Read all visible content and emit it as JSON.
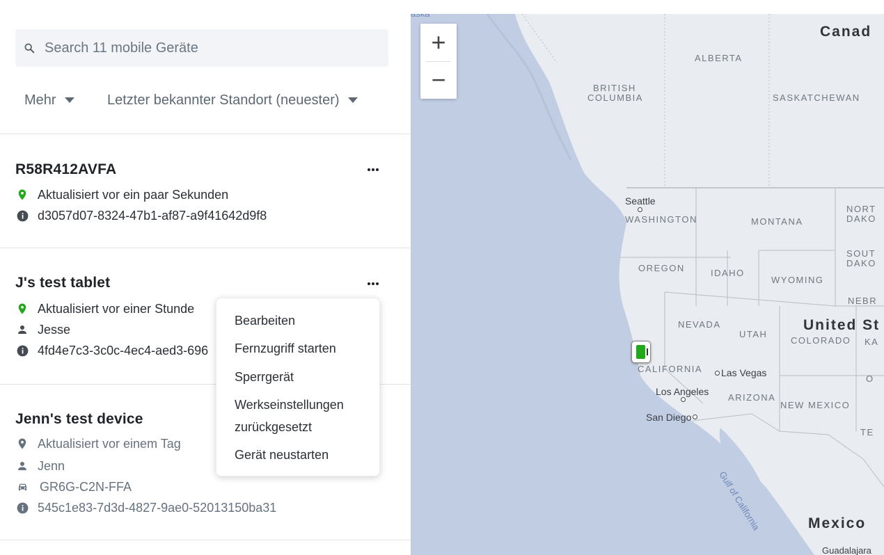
{
  "search": {
    "placeholder": "Search 11 mobile Geräte"
  },
  "filters": {
    "more_label": "Mehr",
    "sort_label": "Letzter bekannter Standort (neuester)"
  },
  "devices": [
    {
      "name": "R58R412AVFA",
      "updated": "Aktualisiert vor ein paar Sekunden",
      "id": "d3057d07-8324-47b1-af87-a9f41642d9f8"
    },
    {
      "name": "J's test tablet",
      "updated": "Aktualisiert vor einer Stunde",
      "user": "Jesse",
      "id": "4fd4e7c3-3c0c-4ec4-aed3-696"
    },
    {
      "name": "Jenn's test device",
      "updated": "Aktualisiert vor einem Tag",
      "user": "Jenn",
      "vehicle": "GR6G-C2N-FFA",
      "id": "545c1e83-7d3d-4827-9ae0-52013150ba31"
    }
  ],
  "menu": {
    "items": [
      "Bearbeiten",
      "Fernzugriff starten",
      "Sperrgerät",
      "Werkseinstellungen",
      "zurückgesetzt",
      "Gerät neustarten"
    ]
  },
  "map": {
    "zoom_in": "+",
    "zoom_out": "−",
    "countries": [
      "Canad",
      "United St",
      "Mexico"
    ],
    "regions": [
      "ALBERTA",
      "BRITISH",
      "COLUMBIA",
      "SASKATCHEWAN",
      "WASHINGTON",
      "MONTANA",
      "NORT",
      "DAKO",
      "OREGON",
      "IDAHO",
      "WYOMING",
      "SOUT",
      "DAKO",
      "NEBR",
      "NEVADA",
      "UTAH",
      "COLORADO",
      "KA",
      "CALIFORNIA",
      "ARIZONA",
      "NEW MEXICO",
      "TE",
      "O"
    ],
    "cities": [
      "Seattle",
      "Las Vegas",
      "Los Angeles",
      "San Diego",
      "Guadalajara"
    ],
    "water": [
      "Gulf of California",
      "aska"
    ]
  },
  "colors": {
    "status_green": "#22a81a",
    "ocean": "#c1cde3",
    "land": "#e9ecf0",
    "muted_text": "#66727e"
  }
}
